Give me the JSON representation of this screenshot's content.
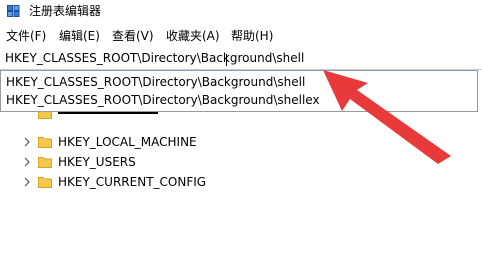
{
  "window": {
    "title": "注册表编辑器"
  },
  "menu": [
    "文件(F)",
    "编辑(E)",
    "查看(V)",
    "收藏夹(A)",
    "帮助(H)"
  ],
  "address": {
    "value": "HKEY_CLASSES_ROOT\\Directory\\Background\\shell"
  },
  "suggestions": [
    "HKEY_CLASSES_ROOT\\Directory\\Background\\shell",
    "HKEY_CLASSES_ROOT\\Directory\\Background\\shellex"
  ],
  "tree": {
    "items": [
      "HKEY_LOCAL_MACHINE",
      "HKEY_USERS",
      "HKEY_CURRENT_CONFIG"
    ]
  },
  "colors": {
    "arrow": "#e8393b",
    "folder": "#f2c94c",
    "folder_edge": "#d9a520",
    "dropdown_border": "#9a9a9a"
  },
  "icons": {
    "app": "registry-editor-icon",
    "expand": "chevron-right-icon",
    "folder": "folder-icon"
  }
}
